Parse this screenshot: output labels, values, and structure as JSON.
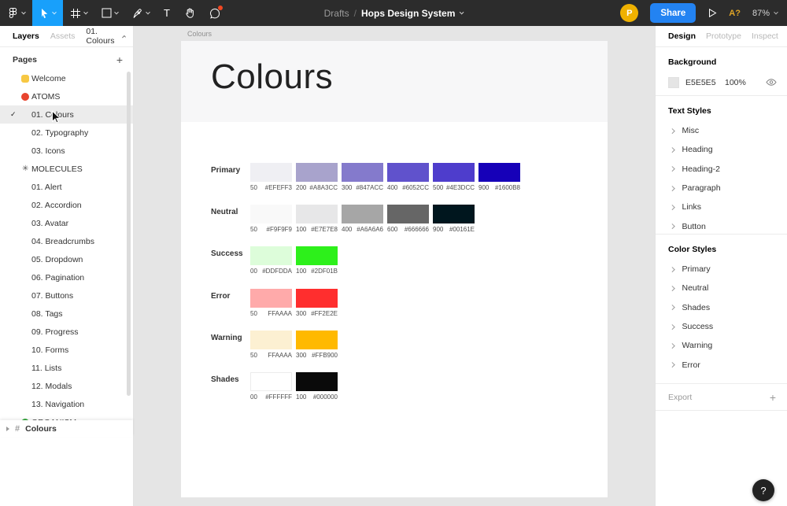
{
  "colors": {
    "active_tool": "#18A0FB",
    "share_button": "#2383F2",
    "avatar": "#EFB100",
    "notification_dot": "#F24822",
    "canvas_background": "#E5E5E5"
  },
  "icons": {
    "plus": "+",
    "checkmark": "✓",
    "asterisk": "✳",
    "hash": "#",
    "text_tool": "T"
  },
  "toolbar": {
    "breadcrumb": {
      "project": "Drafts",
      "separator": "/",
      "file": "Hops Design System"
    },
    "avatar_initial": "P",
    "share_label": "Share",
    "beta_label": "A?",
    "zoom_level": "87%"
  },
  "left_panel": {
    "tabs": [
      {
        "label": "Layers",
        "active": true
      },
      {
        "label": "Assets",
        "active": false
      }
    ],
    "page_indicator": "01. Colours",
    "pages_header": "Pages",
    "pages": [
      {
        "label": "Welcome",
        "icon": "hand-emoji"
      },
      {
        "label": "ATOMS",
        "icon": "red-circle"
      },
      {
        "label": "01. Colours",
        "selected": true
      },
      {
        "label": "02. Typography"
      },
      {
        "label": "03. Icons"
      },
      {
        "label": "MOLECULES",
        "icon": "asterisk"
      },
      {
        "label": "01. Alert"
      },
      {
        "label": "02. Accordion"
      },
      {
        "label": "03. Avatar"
      },
      {
        "label": "04. Breadcrumbs"
      },
      {
        "label": "05. Dropdown"
      },
      {
        "label": "06. Pagination"
      },
      {
        "label": "07. Buttons"
      },
      {
        "label": "08. Tags"
      },
      {
        "label": "09. Progress"
      },
      {
        "label": "10. Forms"
      },
      {
        "label": "11. Lists"
      },
      {
        "label": "12. Modals"
      },
      {
        "label": "13. Navigation"
      },
      {
        "label": "ORGANISM",
        "icon": "green-circle"
      }
    ],
    "bottom_layer": {
      "label": "Colours"
    }
  },
  "canvas": {
    "frame_label": "Colours",
    "frame_title": "Colours",
    "palette": [
      {
        "name": "Primary",
        "swatches": [
          {
            "step": "50",
            "hex": "#EFEFF3",
            "fill": "#EFEFF3"
          },
          {
            "step": "200",
            "hex": "#A8A3CC",
            "fill": "#A8A3CC"
          },
          {
            "step": "300",
            "hex": "#847ACC",
            "fill": "#847ACC"
          },
          {
            "step": "400",
            "hex": "#6052CC",
            "fill": "#6052CC"
          },
          {
            "step": "500",
            "hex": "#4E3DCC",
            "fill": "#4E3DCC"
          },
          {
            "step": "900",
            "hex": "#1600B8",
            "fill": "#1600B8"
          }
        ]
      },
      {
        "name": "Neutral",
        "swatches": [
          {
            "step": "50",
            "hex": "#F9F9F9",
            "fill": "#F9F9F9"
          },
          {
            "step": "100",
            "hex": "#E7E7E8",
            "fill": "#E7E7E8"
          },
          {
            "step": "400",
            "hex": "#A6A6A6",
            "fill": "#A6A6A6"
          },
          {
            "step": "600",
            "hex": "#666666",
            "fill": "#666666"
          },
          {
            "step": "900",
            "hex": "#00161E",
            "fill": "#00161E"
          }
        ]
      },
      {
        "name": "Success",
        "swatches": [
          {
            "step": "00",
            "hex": "#DDFDDA",
            "fill": "#DDFDDA"
          },
          {
            "step": "100",
            "hex": "#2DF01B",
            "fill": "#2DF01B"
          }
        ]
      },
      {
        "name": "Error",
        "swatches": [
          {
            "step": "50",
            "hex": "FFAAAA",
            "fill": "#FFAAAA"
          },
          {
            "step": "300",
            "hex": "#FF2E2E",
            "fill": "#FF2E2E"
          }
        ]
      },
      {
        "name": "Warning",
        "swatches": [
          {
            "step": "50",
            "hex": "FFAAAA",
            "fill": "#FCF0D2"
          },
          {
            "step": "300",
            "hex": "#FFB900",
            "fill": "#FFB900"
          }
        ]
      },
      {
        "name": "Shades",
        "swatches": [
          {
            "step": "00",
            "hex": "#FFFFFF",
            "fill": "#FFFFFF",
            "border": true
          },
          {
            "step": "100",
            "hex": "#000000",
            "fill": "#0A0A0A"
          }
        ]
      }
    ]
  },
  "right_panel": {
    "tabs": [
      {
        "label": "Design",
        "active": true
      },
      {
        "label": "Prototype"
      },
      {
        "label": "Inspect"
      }
    ],
    "background": {
      "header": "Background",
      "hex": "E5E5E5",
      "opacity": "100%"
    },
    "text_styles": {
      "header": "Text Styles",
      "items": [
        "Misc",
        "Heading",
        "Heading-2",
        "Paragraph",
        "Links",
        "Button"
      ]
    },
    "color_styles": {
      "header": "Color Styles",
      "items": [
        "Primary",
        "Neutral",
        "Shades",
        "Success",
        "Warning",
        "Error"
      ]
    },
    "export_label": "Export"
  },
  "help_button": {
    "label": "?"
  }
}
